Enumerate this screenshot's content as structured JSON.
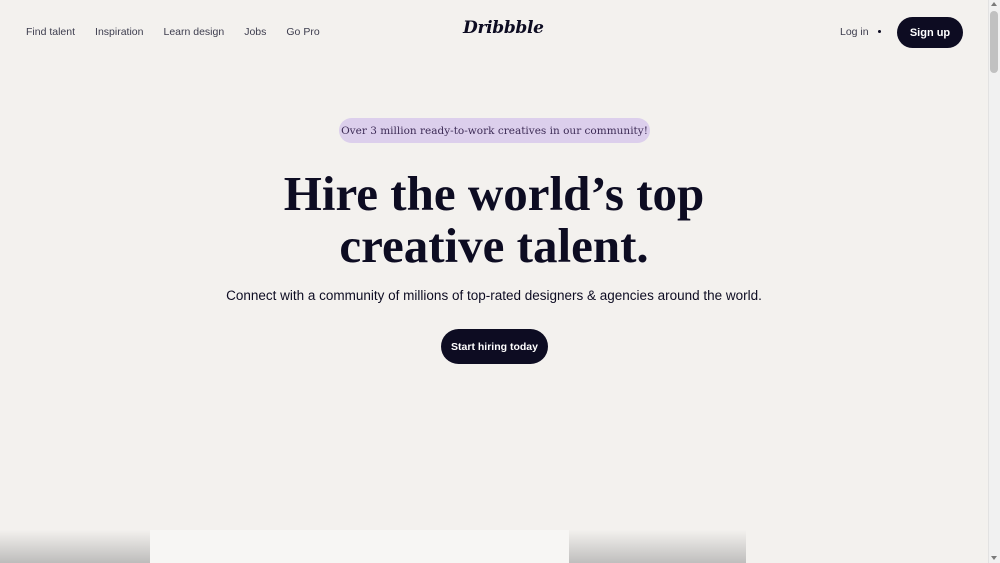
{
  "header": {
    "nav": [
      "Find talent",
      "Inspiration",
      "Learn design",
      "Jobs",
      "Go Pro"
    ],
    "logo": "Dribbble",
    "login": "Log in",
    "signup": "Sign up"
  },
  "hero": {
    "badge": "Over 3 million ready-to-work creatives in our community!",
    "headline_line1": "Hire the world’s top",
    "headline_line2": "creative talent.",
    "subhead": "Connect with a community of millions of top-rated designers & agencies around the world.",
    "cta": "Start hiring today"
  },
  "colors": {
    "background": "#f3f1ee",
    "primary": "#0d0c22",
    "badge_bg": "#dccfec"
  }
}
